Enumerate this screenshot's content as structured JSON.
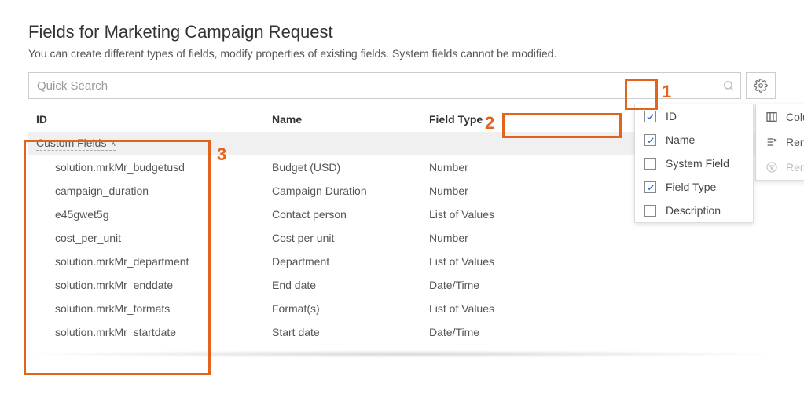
{
  "title": "Fields for Marketing Campaign Request",
  "subtitle": "You can create different types of fields, modify properties of existing fields. System fields cannot be modified.",
  "search": {
    "placeholder": "Quick Search"
  },
  "table": {
    "headers": {
      "id": "ID",
      "name": "Name",
      "type": "Field Type"
    },
    "group_label": "Custom Fields",
    "rows": [
      {
        "id": "solution.mrkMr_budgetusd",
        "name": "Budget (USD)",
        "type": "Number"
      },
      {
        "id": "campaign_duration",
        "name": "Campaign Duration",
        "type": "Number"
      },
      {
        "id": "e45gwet5g",
        "name": "Contact person",
        "type": "List of Values"
      },
      {
        "id": "cost_per_unit",
        "name": "Cost per unit",
        "type": "Number"
      },
      {
        "id": "solution.mrkMr_department",
        "name": "Department",
        "type": "List of Values"
      },
      {
        "id": "solution.mrkMr_enddate",
        "name": "End date",
        "type": "Date/Time"
      },
      {
        "id": "solution.mrkMr_formats",
        "name": "Format(s)",
        "type": "List of Values"
      },
      {
        "id": "solution.mrkMr_startdate",
        "name": "Start date",
        "type": "Date/Time"
      }
    ]
  },
  "gear_menu": {
    "columns": "Columns",
    "remove_grouping": "Remove grouping",
    "remove_filter": "Remove filter"
  },
  "columns_menu": [
    {
      "label": "ID",
      "checked": true
    },
    {
      "label": "Name",
      "checked": true
    },
    {
      "label": "System Field",
      "checked": false
    },
    {
      "label": "Field Type",
      "checked": true
    },
    {
      "label": "Description",
      "checked": false
    }
  ],
  "annotations": {
    "n1": "1",
    "n2": "2",
    "n3": "3"
  }
}
